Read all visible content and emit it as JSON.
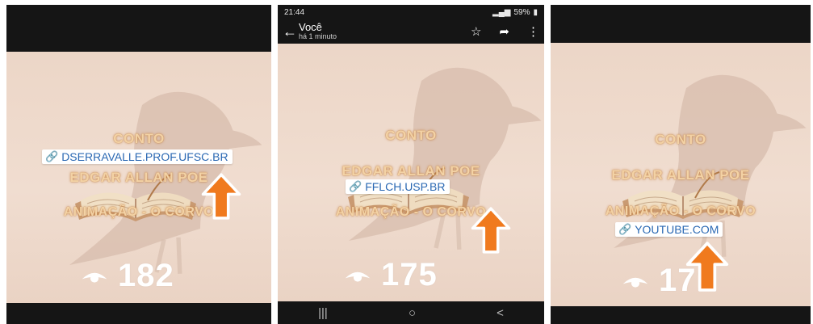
{
  "panels": [
    {
      "labels": {
        "conto": "CONTO",
        "author": "EDGAR ALLAN POE",
        "animation": "ANIMAÇÃO - O CORVO"
      },
      "link": "DSERRAVALLE.PROF.UFSC.BR",
      "views": "182"
    },
    {
      "status_bar": {
        "time": "21:44",
        "battery": "59%"
      },
      "header": {
        "title": "Você",
        "subtitle": "há 1 minuto"
      },
      "labels": {
        "conto": "CONTO",
        "author": "EDGAR ALLAN POE",
        "animation": "ANIMAÇÃO - O CORVO"
      },
      "link": "FFLCH.USP.BR",
      "views": "175",
      "nav": {
        "recents": "|||",
        "home": "○",
        "back": "<"
      }
    },
    {
      "labels": {
        "conto": "CONTO",
        "author": "EDGAR ALLAN POE",
        "animation": "ANIMAÇÃO - O CORVO"
      },
      "link": "YOUTUBE.COM",
      "views": "171"
    }
  ],
  "icons": {
    "link": "link-icon",
    "eye": "eye-icon",
    "arrow": "arrow-up-icon",
    "back": "arrow-left-icon",
    "star": "star-icon",
    "share": "share-icon",
    "more": "more-vertical-icon"
  },
  "colors": {
    "background": "#151515",
    "story": "#ecd6c7",
    "arrow": "#f07a1e",
    "link_text": "#2a68b3",
    "label": "#f3d2a5"
  }
}
